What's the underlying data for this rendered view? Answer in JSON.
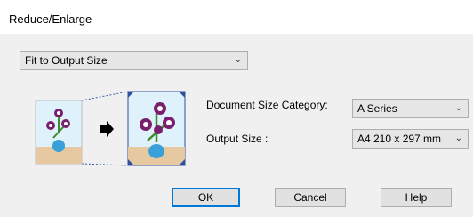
{
  "window": {
    "title": "Reduce/Enlarge"
  },
  "mode_select": {
    "value": "Fit to Output Size"
  },
  "document_size_category": {
    "label": "Document Size Category:",
    "value": "A Series"
  },
  "output_size": {
    "label": "Output Size :",
    "value": "A4 210 x 297 mm"
  },
  "buttons": {
    "ok": "OK",
    "cancel": "Cancel",
    "help": "Help"
  },
  "icons": [
    "original-document-icon",
    "arrow-right-icon",
    "enlarged-document-icon",
    "corner-arrow-icon"
  ],
  "colors": {
    "flower_purple": "#7a1f6e",
    "vase_blue": "#3aa0d8",
    "frame_blue": "#2f4f9f",
    "table_tan": "#e6c9a0"
  }
}
